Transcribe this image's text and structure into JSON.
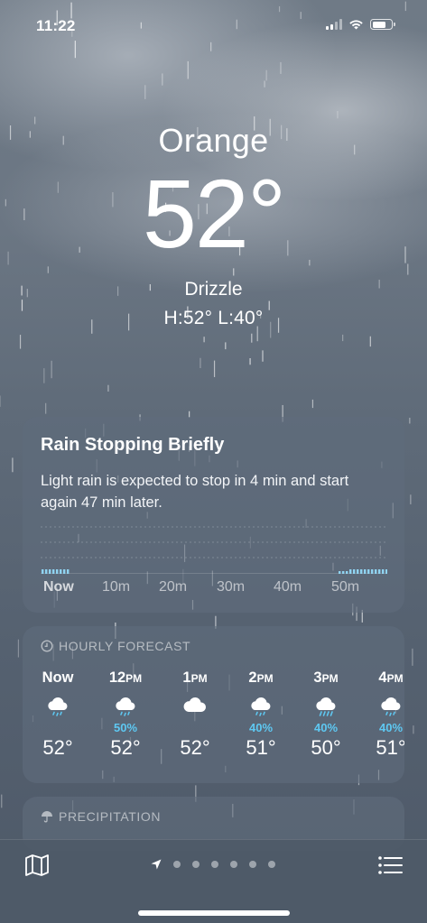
{
  "status_bar": {
    "time": "11:22"
  },
  "location": {
    "city": "Orange",
    "temperature": "52°",
    "condition": "Drizzle",
    "high_low": "H:52°  L:40°"
  },
  "precip_card": {
    "title": "Rain Stopping Briefly",
    "description": "Light rain is expected to stop in 4 min and start again 47 min later.",
    "time_labels": [
      "Now",
      "10m",
      "20m",
      "30m",
      "40m",
      "50m"
    ]
  },
  "hourly": {
    "header": "HOURLY FORECAST",
    "items": [
      {
        "time": "Now",
        "suffix": "",
        "icon": "rain-cloud-icon",
        "pop": "",
        "temp": "52°"
      },
      {
        "time": "12",
        "suffix": "PM",
        "icon": "rain-cloud-icon",
        "pop": "50%",
        "temp": "52°"
      },
      {
        "time": "1",
        "suffix": "PM",
        "icon": "cloud-icon",
        "pop": "",
        "temp": "52°"
      },
      {
        "time": "2",
        "suffix": "PM",
        "icon": "rain-cloud-icon",
        "pop": "40%",
        "temp": "51°"
      },
      {
        "time": "3",
        "suffix": "PM",
        "icon": "heavy-rain-cloud-icon",
        "pop": "40%",
        "temp": "50°"
      },
      {
        "time": "4",
        "suffix": "PM",
        "icon": "rain-cloud-icon",
        "pop": "40%",
        "temp": "51°"
      }
    ]
  },
  "precipitation": {
    "header": "PRECIPITATION"
  },
  "toolbar": {
    "map_icon": "map-icon",
    "list_icon": "list-icon",
    "page_count": 6
  },
  "colors": {
    "pop_text": "#5ec8f2",
    "rain_bar": "#8fd3f0"
  }
}
